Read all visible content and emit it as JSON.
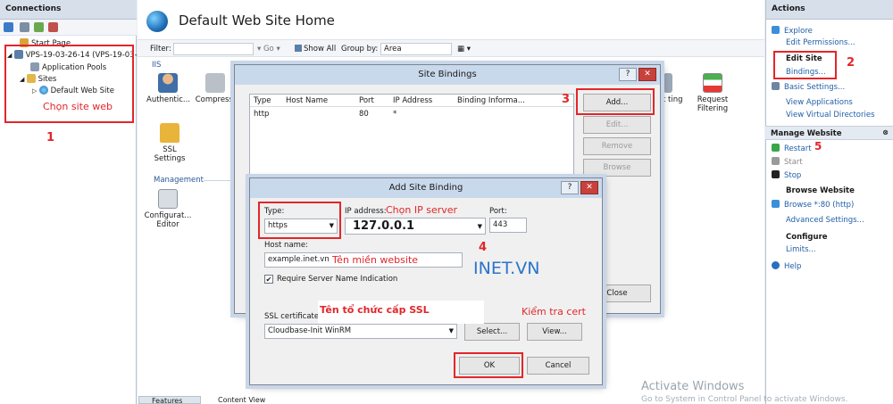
{
  "connections": {
    "header": "Connections",
    "tree": {
      "start_page": "Start Page",
      "server": "VPS-19-03-26-14 (VPS-19-03-",
      "app_pools": "Application Pools",
      "sites": "Sites",
      "default_site": "Default Web Site"
    }
  },
  "main": {
    "title": "Default Web Site Home",
    "filter": {
      "filter_label": "Filter:",
      "go_label": "Go",
      "show_all": "Show All",
      "group_by": "Group by:",
      "group_value": "Area"
    },
    "iis_section": "IIS",
    "features_iis": [
      "Authentic...",
      "Compressi"
    ],
    "features_right": [
      "out ting",
      "Request Filtering"
    ],
    "ssl_settings": "SSL Settings",
    "management_section": "Management",
    "config_editor": "Configurat... Editor",
    "bottom_tabs": [
      "Features View",
      "Content View"
    ]
  },
  "site_bindings": {
    "title": "Site Bindings",
    "columns": [
      "Type",
      "Host Name",
      "Port",
      "IP Address",
      "Binding Informa..."
    ],
    "rows": [
      {
        "type": "http",
        "host": "",
        "port": "80",
        "ip": "*",
        "info": ""
      }
    ],
    "buttons": {
      "add": "Add...",
      "edit": "Edit...",
      "remove": "Remove",
      "browse": "Browse",
      "close": "Close"
    }
  },
  "add_binding": {
    "title": "Add Site Binding",
    "type_label": "Type:",
    "type_value": "https",
    "ip_label": "IP address:",
    "ip_value": "127.0.0.1",
    "port_label": "Port:",
    "port_value": "443",
    "host_label": "Host name:",
    "host_value": "example.inet.vn",
    "sni_label": "Require Server Name Indication",
    "ssl_label": "SSL certificate:",
    "ssl_value": "Cloudbase-Init WinRM",
    "select_btn": "Select...",
    "view_btn": "View...",
    "ok_btn": "OK",
    "cancel_btn": "Cancel"
  },
  "actions": {
    "header": "Actions",
    "explore": "Explore",
    "edit_permissions": "Edit Permissions...",
    "edit_site": "Edit Site",
    "bindings": "Bindings...",
    "basic_settings": "Basic Settings...",
    "view_apps": "View Applications",
    "view_vdirs": "View Virtual Directories",
    "manage_website": "Manage Website",
    "restart": "Restart",
    "start": "Start",
    "stop": "Stop",
    "browse_website": "Browse Website",
    "browse_80": "Browse *:80 (http)",
    "advanced_settings": "Advanced Settings...",
    "configure": "Configure",
    "limits": "Limits...",
    "help": "Help"
  },
  "annotations": {
    "step1_text": "Chọn site web",
    "step1": "1",
    "step2": "2",
    "step3": "3",
    "step4": "4",
    "step5": "5",
    "choose_ip": "Chọn IP server",
    "domain_name": "Tên miền website",
    "brand": "INET.VN",
    "ssl_org": "Tên tổ chức cấp SSL",
    "check_cert": "Kiểm tra cert"
  },
  "watermark": {
    "line1": "Activate Windows",
    "line2": "Go to System in Control Panel to activate Windows."
  },
  "colors": {
    "annotation_red": "#e2262a",
    "link_blue": "#1f5fa8",
    "pane_header": "#d6dfea"
  }
}
